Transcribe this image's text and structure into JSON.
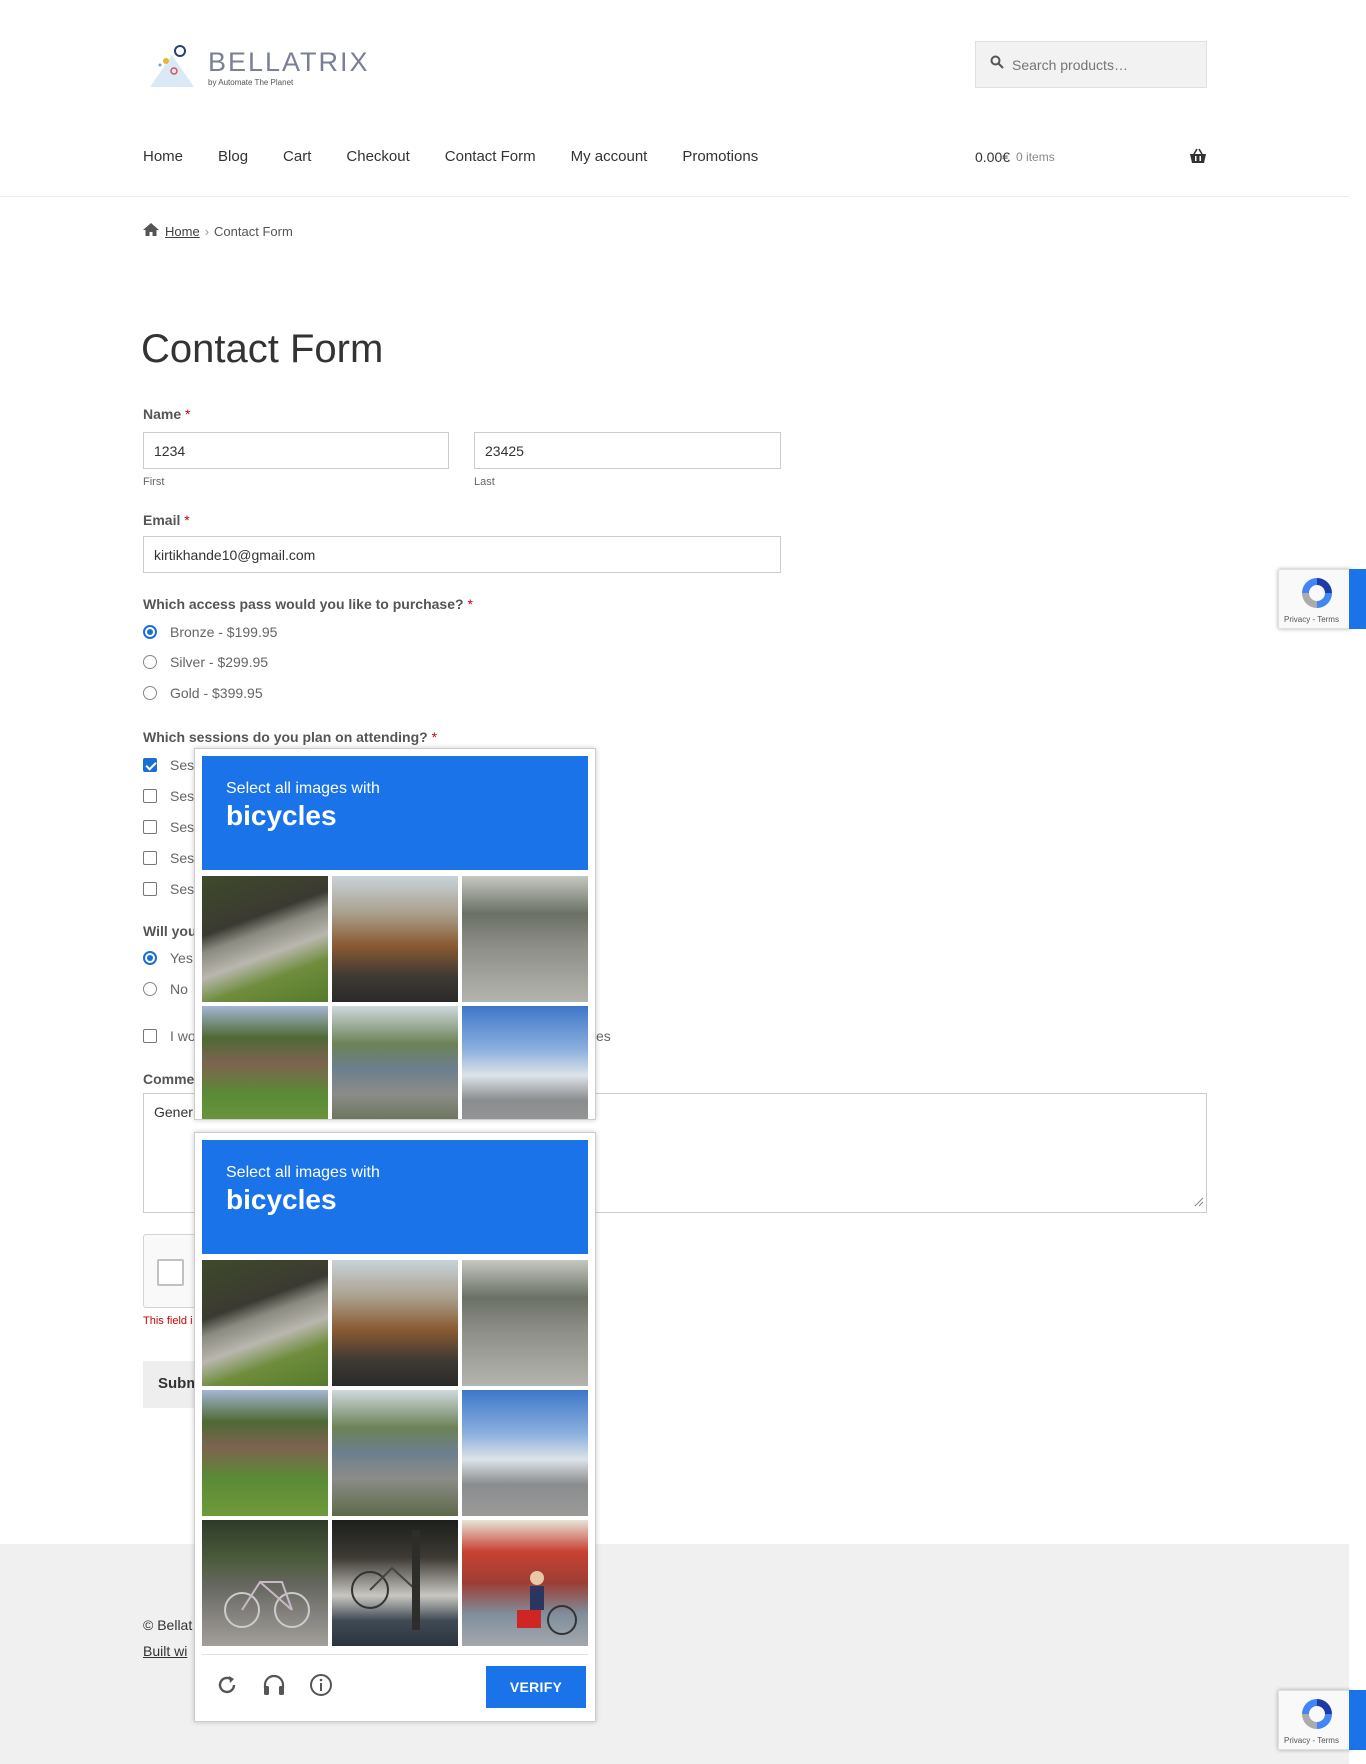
{
  "header": {
    "logo_name": "BELLATRIX",
    "logo_sub": "by Automate The Planet",
    "search_placeholder": "Search products…",
    "nav": [
      "Home",
      "Blog",
      "Cart",
      "Checkout",
      "Contact Form",
      "My account",
      "Promotions"
    ],
    "cart_amount": "0.00€",
    "cart_items": "0 items"
  },
  "breadcrumb": {
    "home": "Home",
    "current": "Contact Form"
  },
  "page_title": "Contact Form",
  "form": {
    "name_label": "Name",
    "required_mark": "*",
    "first_value": "1234",
    "first_sub": "First",
    "last_value": "23425",
    "last_sub": "Last",
    "email_label": "Email",
    "email_value": "kirtikhande10@gmail.com",
    "pass_label": "Which access pass would you like to purchase?",
    "pass_options": [
      "Bronze - $199.95",
      "Silver - $299.95",
      "Gold - $399.95"
    ],
    "pass_selected": 0,
    "sessions_label": "Which sessions do you plan on attending?",
    "sessions_options": [
      "Ses",
      "Ses",
      "Ses",
      "Ses",
      "Ses"
    ],
    "sessions_checked": [
      true,
      false,
      false,
      false,
      false
    ],
    "will_label": "Will you",
    "will_options": [
      "Yes",
      "No"
    ],
    "will_selected": 0,
    "optin_left": "I wo",
    "optin_right": "es",
    "comments_label": "Comme",
    "comments_value": "Gener",
    "error_text": "This field i",
    "submit_label": "Subm"
  },
  "captcha": {
    "instruction": "Select all images with",
    "target": "bicycles",
    "verify_label": "VERIFY",
    "badge_terms": "Privacy - Terms",
    "tiles_top": [
      "sidewalk",
      "house",
      "street",
      "trees",
      "bus",
      "intersect"
    ],
    "tiles_bottom": [
      "sidewalk",
      "house",
      "street",
      "trees",
      "bus",
      "intersect",
      "bike1",
      "bike2",
      "bike3"
    ]
  },
  "footer": {
    "copy": "© Bellat",
    "built": "Built wi"
  },
  "colors": {
    "accent": "#1a73e8",
    "radio_blue": "#1a6ed8",
    "error": "#cc0000"
  }
}
